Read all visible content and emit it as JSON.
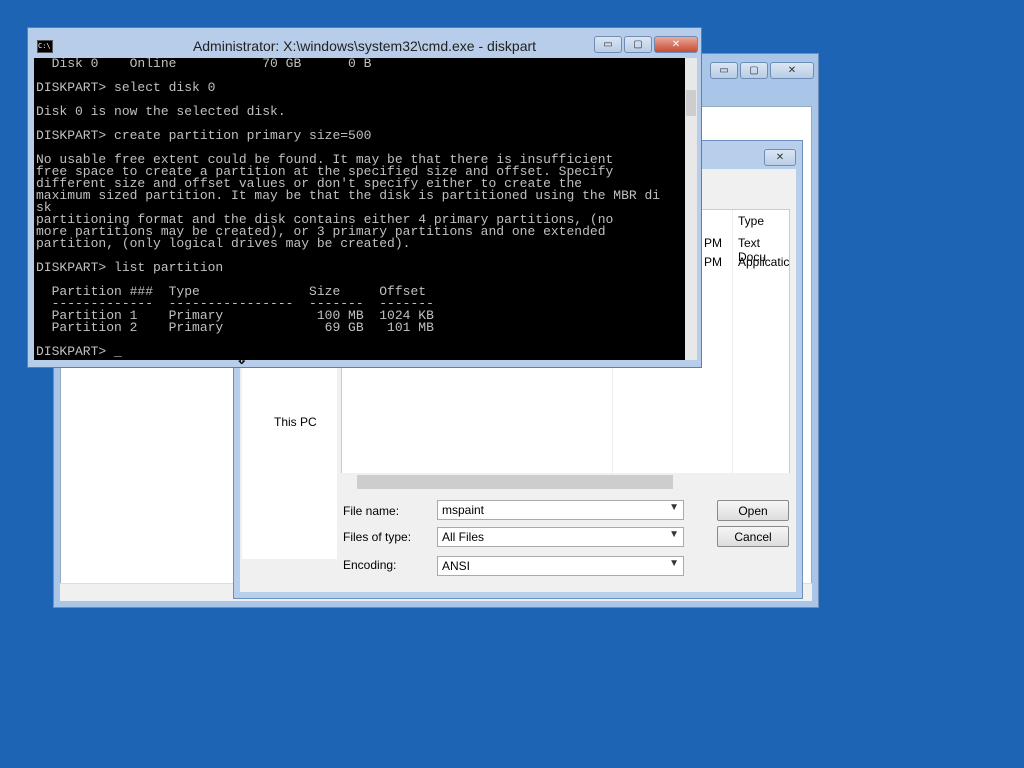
{
  "back_window": {
    "buttons": {
      "minimize": "▭",
      "maximize": "▢",
      "close": "✕"
    }
  },
  "file_dialog": {
    "nav": {
      "this_pc": "This PC"
    },
    "columns": {
      "type": "Type"
    },
    "rows": [
      {
        "time": "PM",
        "type": "Text Docu"
      },
      {
        "time": "PM",
        "type": "Applicatic"
      }
    ],
    "file_name_label": "File name:",
    "file_name_value": "mspaint",
    "files_of_type_label": "Files of type:",
    "files_of_type_value": "All Files",
    "encoding_label": "Encoding:",
    "encoding_value": "ANSI",
    "open_label": "Open",
    "cancel_label": "Cancel",
    "close_symbol": "✕"
  },
  "cmd_window": {
    "title": "Administrator: X:\\windows\\system32\\cmd.exe - diskpart",
    "icon_text": "C:\\",
    "buttons": {
      "minimize": "▭",
      "maximize": "▢",
      "close": "✕"
    },
    "output": "  Disk 0    Online           70 GB      0 B\n\nDISKPART> select disk 0\n\nDisk 0 is now the selected disk.\n\nDISKPART> create partition primary size=500\n\nNo usable free extent could be found. It may be that there is insufficient\nfree space to create a partition at the specified size and offset. Specify\ndifferent size and offset values or don't specify either to create the\nmaximum sized partition. It may be that the disk is partitioned using the MBR di\nsk\npartitioning format and the disk contains either 4 primary partitions, (no\nmore partitions may be created), or 3 primary partitions and one extended\npartition, (only logical drives may be created).\n\nDISKPART> list partition\n\n  Partition ###  Type              Size     Offset\n  -------------  ----------------  -------  -------\n  Partition 1    Primary            100 MB  1024 KB\n  Partition 2    Primary             69 GB   101 MB\n\nDISKPART> _"
  },
  "cursor_glyph": "⇕"
}
